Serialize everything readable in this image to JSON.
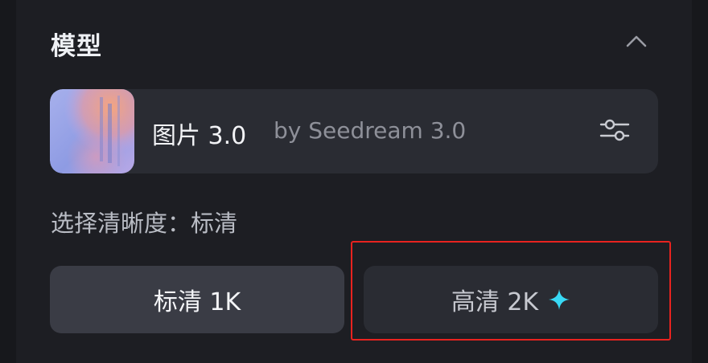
{
  "section": {
    "title": "模型",
    "collapse_icon": "chevron-up-icon"
  },
  "model": {
    "name": "图片 3.0",
    "by": "by Seedream 3.0",
    "settings_icon": "sliders-icon"
  },
  "resolution": {
    "label": "选择清晰度：",
    "selected": "标清"
  },
  "options": [
    {
      "label": "标清 1K",
      "selected": true
    },
    {
      "label": "高清 2K",
      "icon": "sparkle-icon",
      "selected": false
    }
  ],
  "colors": {
    "background": "#17181c",
    "panel": "#1d1e23",
    "card": "#2a2c33",
    "selected_option": "#3a3c45",
    "sparkle": "#38d9f5",
    "highlight_box": "#e8231f"
  }
}
